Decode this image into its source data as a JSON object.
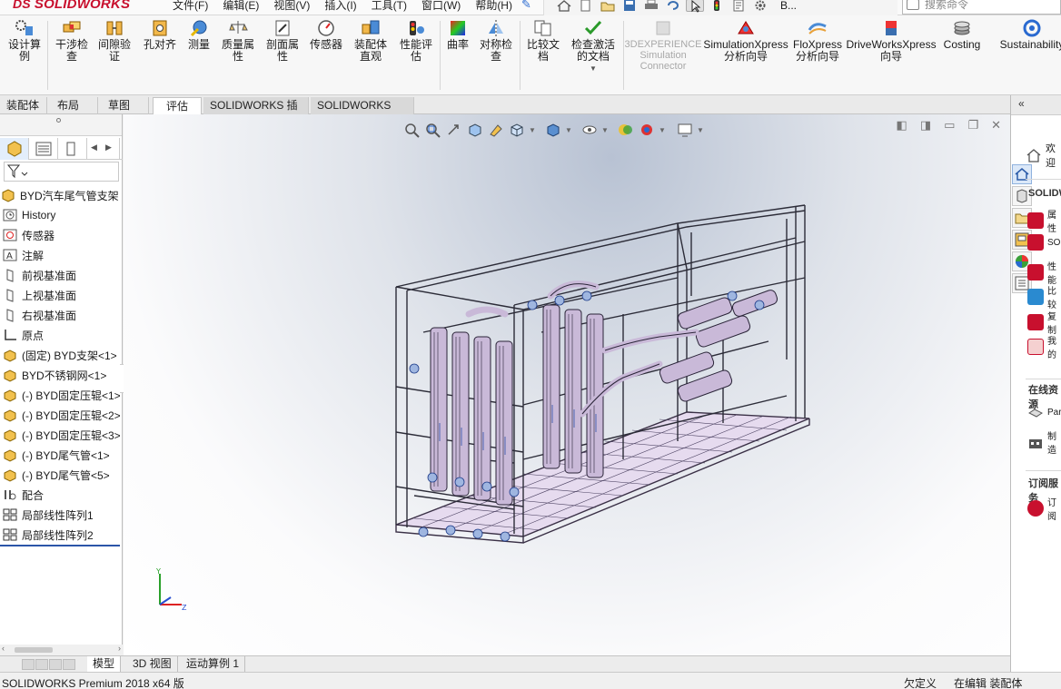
{
  "app": {
    "logo_text": "SOLIDWORKS",
    "logo_mark": "DS",
    "menus": [
      "文件(F)",
      "编辑(E)",
      "视图(V)",
      "插入(I)",
      "工具(T)",
      "窗口(W)",
      "帮助(H)"
    ],
    "quickbar_label": "B...",
    "search_placeholder": "搜索命令"
  },
  "ribbon": {
    "tools": [
      {
        "label": "设计算例",
        "icon": "design-study-icon"
      },
      {
        "label": "干涉检查",
        "icon": "interference-detection-icon"
      },
      {
        "label": "间隙验证",
        "icon": "clearance-verification-icon"
      },
      {
        "label": "孔对齐",
        "icon": "hole-alignment-icon"
      },
      {
        "label": "测量",
        "icon": "measure-icon"
      },
      {
        "label": "质量属性",
        "icon": "mass-properties-icon"
      },
      {
        "label": "剖面属性",
        "icon": "section-properties-icon"
      },
      {
        "label": "传感器",
        "icon": "sensor-icon"
      },
      {
        "label": "装配体直观",
        "icon": "assemblyxpert-icon"
      },
      {
        "label": "性能评估",
        "icon": "performance-evaluation-icon"
      },
      {
        "label": "曲率",
        "icon": "curvature-icon"
      },
      {
        "label": "对称检查",
        "icon": "symmetry-check-icon"
      },
      {
        "label": "比较文档",
        "icon": "compare-documents-icon"
      },
      {
        "label": "检查激活的文档",
        "icon": "check-active-document-icon"
      },
      {
        "label": "3DEXPERIENCE Simulation Connector",
        "icon": "3dexperience-icon",
        "disabled": true
      },
      {
        "label": "SimulationXpress 分析向导",
        "icon": "simulationxpress-icon"
      },
      {
        "label": "FloXpress 分析向导",
        "icon": "floxpress-icon"
      },
      {
        "label": "DriveWorksXpress 向导",
        "icon": "driveworksxpress-icon"
      },
      {
        "label": "Costing",
        "icon": "costing-icon"
      },
      {
        "label": "Sustainability",
        "icon": "sustainability-icon"
      }
    ]
  },
  "command_tabs": [
    "装配体",
    "布局",
    "草图",
    "评估",
    "SOLIDWORKS 插件",
    "SOLIDWORKS MBD"
  ],
  "active_command_tab": "评估",
  "feature_tree": {
    "items": [
      {
        "label": "BYD汽车尾气管支架（默认",
        "icon": "assembly-icon"
      },
      {
        "label": "History",
        "icon": "history-icon"
      },
      {
        "label": "传感器",
        "icon": "sensor-icon"
      },
      {
        "label": "注解",
        "icon": "annotations-icon"
      },
      {
        "label": "前视基准面",
        "icon": "plane-icon"
      },
      {
        "label": "上视基准面",
        "icon": "plane-icon"
      },
      {
        "label": "右视基准面",
        "icon": "plane-icon"
      },
      {
        "label": "原点",
        "icon": "origin-icon"
      },
      {
        "label": "(固定) BYD支架<1>",
        "icon": "part-icon"
      },
      {
        "label": "BYD不锈钢网<1>",
        "icon": "part-icon"
      },
      {
        "label": "(-) BYD固定压辊<1>",
        "icon": "part-icon"
      },
      {
        "label": "(-) BYD固定压辊<2>",
        "icon": "part-icon"
      },
      {
        "label": "(-) BYD固定压辊<3>",
        "icon": "part-icon"
      },
      {
        "label": "(-) BYD尾气管<1>",
        "icon": "part-icon"
      },
      {
        "label": "(-) BYD尾气管<5>",
        "icon": "part-icon"
      },
      {
        "label": "配合",
        "icon": "mates-icon"
      },
      {
        "label": "局部线性阵列1",
        "icon": "pattern-icon"
      },
      {
        "label": "局部线性阵列2",
        "icon": "pattern-icon"
      }
    ]
  },
  "bottom_tabs": [
    "模型",
    "3D 视图",
    "运动算例 1"
  ],
  "status": {
    "left": "SOLIDWORKS Premium 2018 x64 版",
    "custom": "欠定义",
    "mode": "在编辑 装配体"
  },
  "task_pane": {
    "top_item": "欢迎",
    "section1": "SOLIDWORKS",
    "items1": [
      "属性",
      "SOLIDWORKS",
      "性能",
      "比较",
      "复制",
      "我的"
    ],
    "section2": "在线资源",
    "items2": [
      "Partner",
      "制造"
    ],
    "section3": "订阅服务",
    "items3": [
      "订阅"
    ]
  },
  "colors": {
    "brand": "#c8102e",
    "selection_blue": "#2b55a8",
    "model_line": "#2c2c38",
    "model_fill": "#c9b9d8"
  }
}
